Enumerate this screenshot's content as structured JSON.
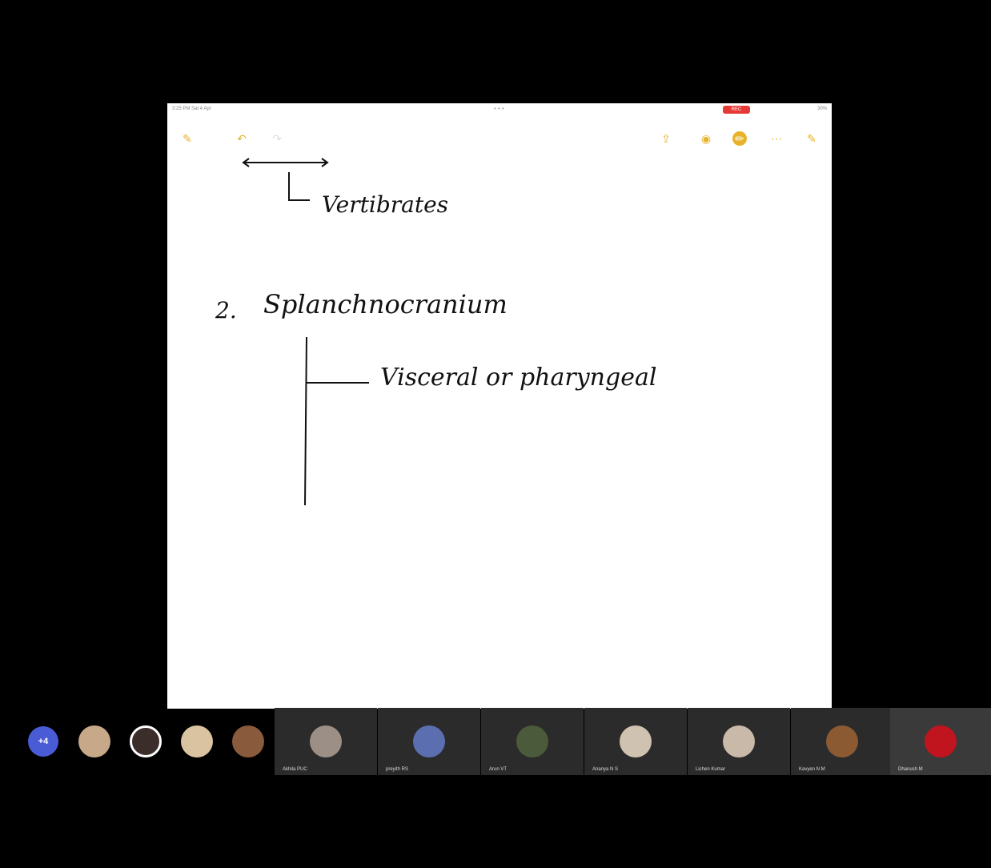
{
  "ipad_status": {
    "time": "3:25 PM  Sat 4 Apr",
    "dots": "• • •",
    "recording_badge": "REC",
    "battery": "30%"
  },
  "toolbar": {
    "icons": [
      "pencil-icon",
      "undo-icon",
      "redo-icon",
      "share-icon",
      "camera-icon",
      "markup-icon",
      "more-icon",
      "compose-icon"
    ],
    "accent": "#e8b32a"
  },
  "note": {
    "line1": "Vertibrates",
    "line2_number": "2.",
    "line2_title": "Splanchnocranium",
    "branch_label": "Visceral  or  pharyngeal"
  },
  "participants": {
    "more_badge": "+4",
    "avatar_colors": [
      "#c7a98a",
      "#3b2d2a",
      "#d9c3a0",
      "#8a5a3c"
    ],
    "video_tiles": [
      {
        "name": "Akhila PUC",
        "color": "#9c8f85"
      },
      {
        "name": "preyith RS",
        "color": "#5b6fb0"
      },
      {
        "name": "Arun VT",
        "color": "#4a5a3a"
      },
      {
        "name": "Ananya N S",
        "color": "#cfc2b0"
      },
      {
        "name": "Lichen Kumar",
        "color": "#c9b9a8"
      },
      {
        "name": "Kavyen N M",
        "color": "#8b5a32"
      },
      {
        "name": "Dhanush M",
        "color": "#c0141e"
      }
    ]
  }
}
